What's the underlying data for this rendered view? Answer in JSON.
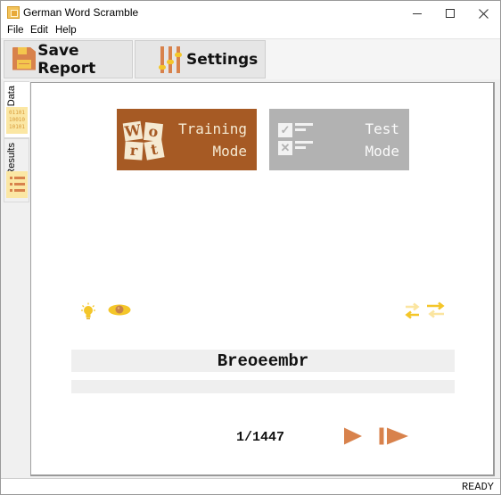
{
  "window": {
    "title": "German Word Scramble",
    "controls": {
      "minimize": "minimize",
      "maximize": "maximize",
      "close": "close"
    }
  },
  "menu": [
    {
      "label": "File"
    },
    {
      "label": "Edit"
    },
    {
      "label": "Help"
    }
  ],
  "toolbar": {
    "save_label": "Save Report",
    "settings_label": "Settings"
  },
  "side_tabs": [
    {
      "label": "Data",
      "icon": "binary-data-icon",
      "icon_text": [
        "01101",
        "10010",
        "10101"
      ],
      "selected": true
    },
    {
      "label": "Results",
      "icon": "list-icon",
      "selected": false
    }
  ],
  "modes": {
    "training": {
      "line1": "Training",
      "line2": "Mode",
      "icon_tiles": [
        "W",
        "o",
        "r",
        "t"
      ],
      "color": "#a65a24",
      "active": true
    },
    "test": {
      "line1": "Test",
      "line2": "Mode",
      "color": "#b2b2b2",
      "active": false
    }
  },
  "tools": {
    "hint": "lightbulb-icon",
    "reveal": "eye-icon",
    "swap": "swap-arrows-icon"
  },
  "quiz": {
    "scrambled_word": "Breoeembr",
    "answer_value": "",
    "counter": "1/1447"
  },
  "colors": {
    "accent_orange": "#d8824c",
    "accent_yellow": "#f4c629",
    "training_brown": "#a65a24",
    "test_gray": "#b2b2b2"
  },
  "status": {
    "text": "READY"
  }
}
